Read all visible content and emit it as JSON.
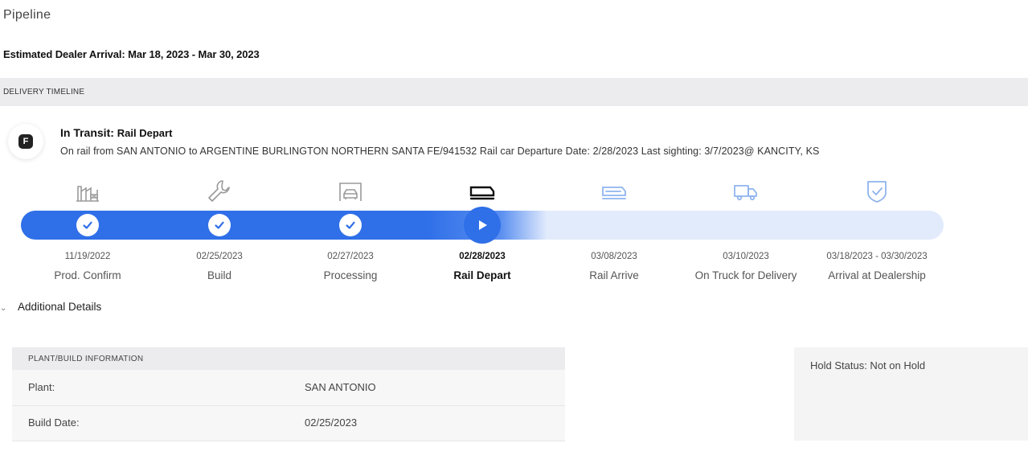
{
  "page": {
    "title": "Pipeline"
  },
  "eta": {
    "text": "Estimated Dealer Arrival: Mar 18, 2023 - Mar 30, 2023"
  },
  "timeline": {
    "section_label": "DELIVERY TIMELINE",
    "badge_letter": "F",
    "status_main": "In Transit:",
    "status_sub": "Rail Depart",
    "status_desc": "On rail from SAN ANTONIO to ARGENTINE BURLINGTON NORTHERN SANTA FE/941532 Rail car Departure Date: 2/28/2023 Last sighting: 3/7/2023@ KANCITY, KS",
    "progress_fraction": 0.5,
    "steps": [
      {
        "date": "11/19/2022",
        "label": "Prod. Confirm",
        "state": "done",
        "icon": "factory-icon"
      },
      {
        "date": "02/25/2023",
        "label": "Build",
        "state": "done",
        "icon": "wrench-icon"
      },
      {
        "date": "02/27/2023",
        "label": "Processing",
        "state": "done",
        "icon": "car-wash-icon"
      },
      {
        "date": "02/28/2023",
        "label": "Rail Depart",
        "state": "current",
        "icon": "rail-car-icon"
      },
      {
        "date": "03/08/2023",
        "label": "Rail Arrive",
        "state": "pending",
        "icon": "rail-car-icon"
      },
      {
        "date": "03/10/2023",
        "label": "On Truck for Delivery",
        "state": "pending",
        "icon": "truck-icon"
      },
      {
        "date": "03/18/2023 - 03/30/2023",
        "label": "Arrival at Dealership",
        "state": "pending",
        "icon": "shield-check-icon"
      }
    ]
  },
  "additional": {
    "label": "Additional Details"
  },
  "plant": {
    "header": "PLANT/BUILD INFORMATION",
    "rows": [
      {
        "key": "Plant:",
        "value": "SAN ANTONIO"
      },
      {
        "key": "Build Date:",
        "value": "02/25/2023"
      }
    ]
  },
  "hold": {
    "text": "Hold Status: Not on Hold"
  },
  "colors": {
    "accent": "#2f6fe8",
    "track_light": "#e2ebfc",
    "done_icon": "#9a9a9a",
    "pending_icon": "#8fb4ee"
  }
}
